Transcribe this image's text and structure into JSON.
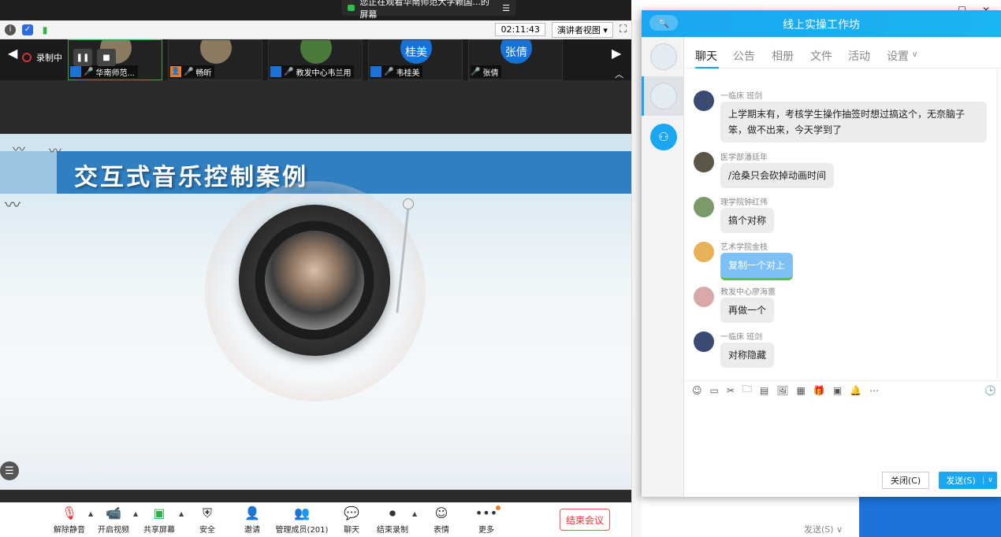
{
  "share_banner": {
    "text": "您正在观看华南师范大学赖国...的屏幕"
  },
  "top_bar": {
    "timer": "02:11:43",
    "view_label": "演讲者视图 ▾",
    "fullscreen": "⛶"
  },
  "recording": {
    "label": "录制中"
  },
  "participants": [
    {
      "name": "华南师范..."
    },
    {
      "name": "畅昕"
    },
    {
      "name": "教发中心韦兰用"
    },
    {
      "name": "韦桂美",
      "avatar_text": "桂美"
    },
    {
      "name": "张倩",
      "avatar_text": "张倩"
    }
  ],
  "slide": {
    "title": "交互式音乐控制案例"
  },
  "toolbar": {
    "unmute": "解除静音",
    "start_video": "开启视频",
    "share_screen": "共享屏幕",
    "security": "安全",
    "invite": "邀请",
    "participants": "管理成员(201)",
    "chat": "聊天",
    "end_recording": "结束录制",
    "reactions": "表情",
    "more": "更多",
    "end_meeting": "结束会议"
  },
  "chat": {
    "title": "线上实操工作坊",
    "tabs": [
      "聊天",
      "公告",
      "相册",
      "文件",
      "活动",
      "设置"
    ],
    "messages": [
      {
        "name": "一临床 班剑",
        "text": "上学期末有，考核学生操作抽签时想过搞这个，无奈脑子笨，做不出来，今天学到了"
      },
      {
        "name": "医学部潘廷年",
        "text": "/沧桑只会砍掉动画时间"
      },
      {
        "name": "理学院钟红伟",
        "text": "搞个对称"
      },
      {
        "name": "艺术学院金枝",
        "text": "复制一个对上"
      },
      {
        "name": "教发中心廖海蕾",
        "text": "再做一个"
      },
      {
        "name": "一临床 班剑",
        "text": "对称隐藏"
      }
    ],
    "close_label": "关闭(C)",
    "send_label": "发送(S)"
  },
  "background": {
    "send_text": "发送(S) ∨"
  },
  "colors": {
    "accent": "#1aa6f0",
    "zoom_blue": "#1373d8",
    "end_red": "#e33333"
  }
}
